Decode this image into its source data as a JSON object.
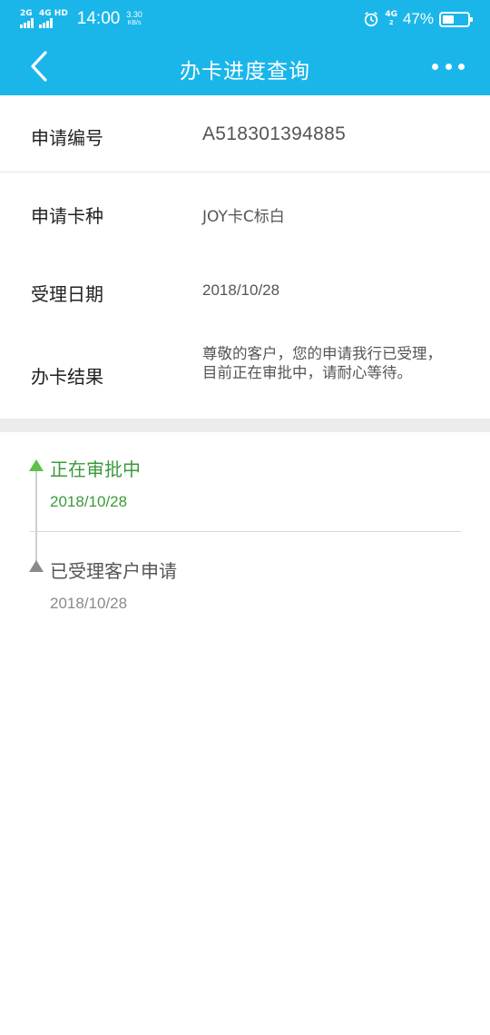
{
  "status_bar": {
    "net1": "2G",
    "net2": "4G HD",
    "time": "14:00",
    "speed_value": "3.30",
    "speed_unit": "KB/s",
    "net3": "4G",
    "net3_sub": "2",
    "battery_percent": "47%",
    "battery_level": 0.47
  },
  "header": {
    "title": "办卡进度查询",
    "back_icon": "chevron-left-icon",
    "more_icon": "more-dots-icon",
    "background_color": "#1ab6ea"
  },
  "info": {
    "rows": [
      {
        "label": "申请编号",
        "value": "A518301394885"
      },
      {
        "label": "申请卡种",
        "value": "JOY卡C标白"
      },
      {
        "label": "受理日期",
        "value": "2018/10/28"
      },
      {
        "label": "办卡结果",
        "value": "尊敬的客户，您的申请我行已受理，目前正在审批中，请耐心等待。"
      }
    ]
  },
  "timeline": {
    "steps": [
      {
        "title": "正在审批中",
        "date": "2018/10/28",
        "color": "#3a9b3a",
        "active": true
      },
      {
        "title": "已受理客户申请",
        "date": "2018/10/28",
        "color": "#8a8a8a",
        "active": false
      }
    ]
  }
}
